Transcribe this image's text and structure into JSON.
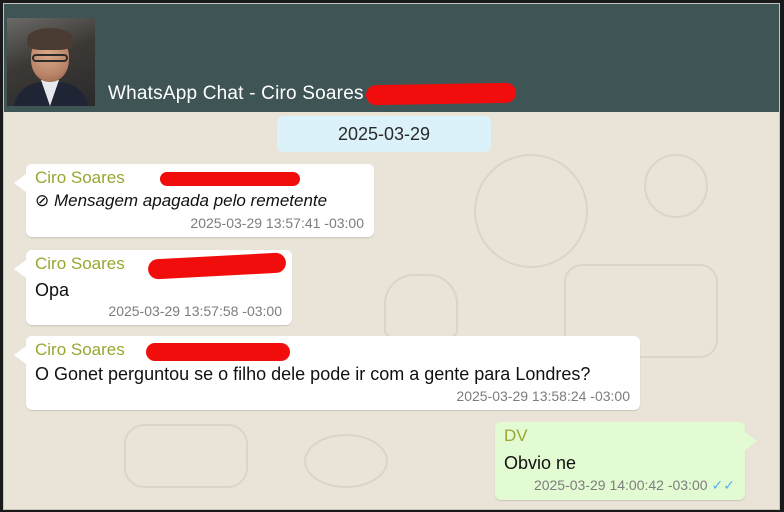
{
  "header": {
    "title": "WhatsApp Chat - Ciro Soares"
  },
  "date_separator": "2025-03-29",
  "messages": [
    {
      "sender": "Ciro Soares",
      "text": "⊘ Mensagem apagada pelo remetente",
      "time": "2025-03-29 13:57:41 -03:00"
    },
    {
      "sender": "Ciro Soares",
      "text": "Opa",
      "time": "2025-03-29 13:57:58 -03:00"
    },
    {
      "sender": "Ciro Soares",
      "text": "O Gonet perguntou se o filho dele pode ir com a gente para Londres?",
      "time": "2025-03-29 13:58:24 -03:00"
    },
    {
      "sender": "DV",
      "text": "Obvio ne",
      "time": "2025-03-29 14:00:42 -03:00",
      "status_icon": "double-check-icon"
    }
  ],
  "colors": {
    "header_bg": "#3e5455",
    "sender_name": "#9aa630",
    "outgoing_bubble": "#e3fbd2",
    "redaction": "#f20d0d",
    "read_ticks": "#5ab3e6"
  }
}
